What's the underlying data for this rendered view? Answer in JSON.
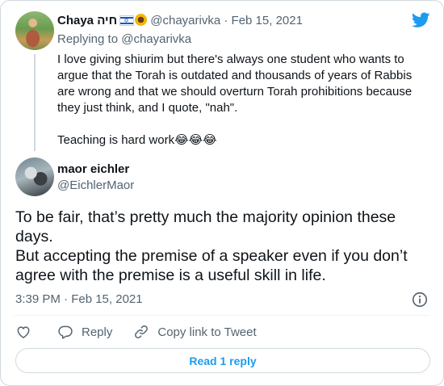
{
  "parent_tweet": {
    "display_name": "Chaya חיה",
    "handle": "@chayarivka",
    "date": "Feb 15, 2021",
    "separator": "·",
    "replying_to_prefix": "Replying to ",
    "replying_to_handle": "@chayarivka",
    "text": "I love giving shiurim but there's always one student who wants to argue that the Torah is outdated and thousands of years of Rabbis are wrong and that we should overturn Torah prohibitions because they just think, and I quote, \"nah\".\n\nTeaching is hard work😂😂😂"
  },
  "main_tweet": {
    "display_name": "maor eichler",
    "handle": "@EichlerMaor",
    "text": "To be fair, that’s pretty much the majority opinion these days.\nBut accepting the premise of a speaker even if you don’t agree with the premise is a useful skill in life.",
    "timestamp": "3:39 PM · Feb 15, 2021"
  },
  "actions": {
    "reply_label": "Reply",
    "copy_link_label": "Copy link to Tweet"
  },
  "read_replies_label": "Read 1 reply",
  "icons": [
    "twitter-bird-icon",
    "israel-flag-icon",
    "sunflower-icon",
    "info-icon",
    "heart-icon",
    "reply-icon",
    "link-icon"
  ],
  "colors": {
    "brand_blue": "#1d9bf0",
    "muted": "#536471",
    "border": "#cfd9de"
  }
}
